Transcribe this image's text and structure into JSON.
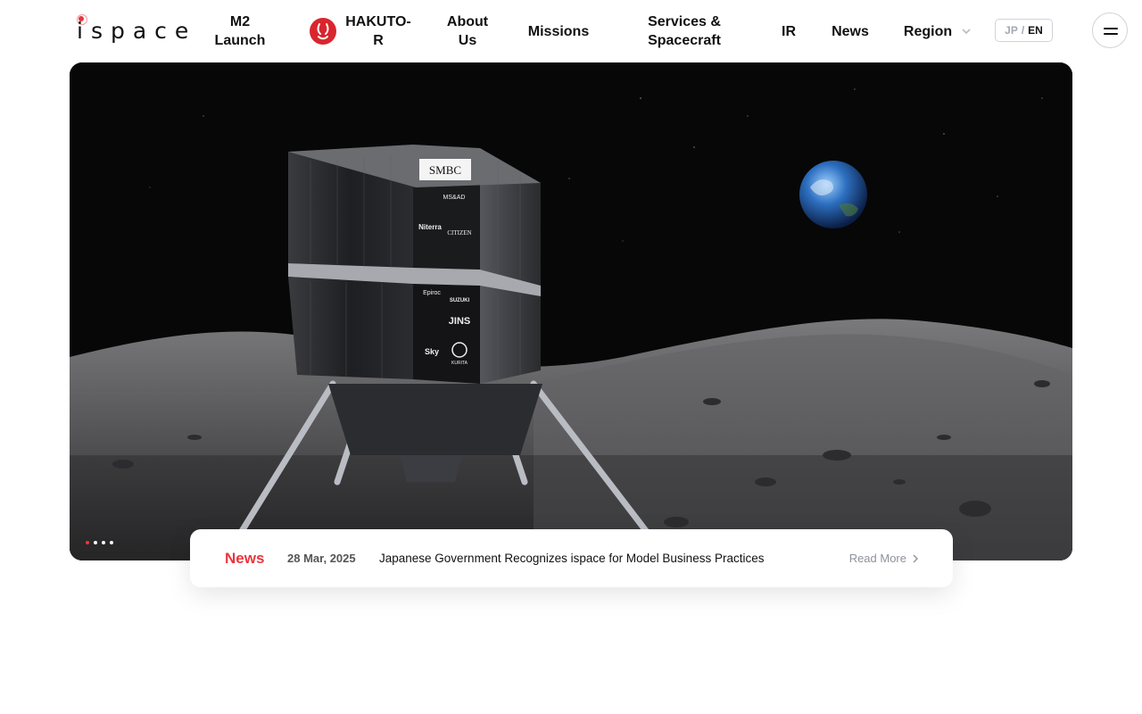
{
  "logo": {
    "text": "ispace"
  },
  "nav": {
    "m2_launch": [
      "M2",
      "Launch"
    ],
    "hakuto": [
      "HAKUTO-",
      "R"
    ],
    "about": [
      "About",
      "Us"
    ],
    "missions": "Missions",
    "services": [
      "Services &",
      "Spacecraft"
    ],
    "ir": "IR",
    "news": "News",
    "region": "Region"
  },
  "lang": {
    "jp": "JP",
    "separator": "/",
    "en": "EN",
    "active": "EN"
  },
  "hero": {
    "slide_count": 4,
    "active_slide": 1,
    "lander_logos": [
      "SMBC",
      "MS&AD",
      "Niterra",
      "CITIZEN",
      "Epiroc",
      "SUZUKI",
      "JINS",
      "Sky",
      "KURITA"
    ]
  },
  "news_bar": {
    "label": "News",
    "date": "28 Mar, 2025",
    "title": "Japanese Government Recognizes ispace for Model Business Practices",
    "read_more": "Read More"
  },
  "colors": {
    "accent": "#e8363d",
    "text": "#111111",
    "muted": "#8d929b"
  }
}
